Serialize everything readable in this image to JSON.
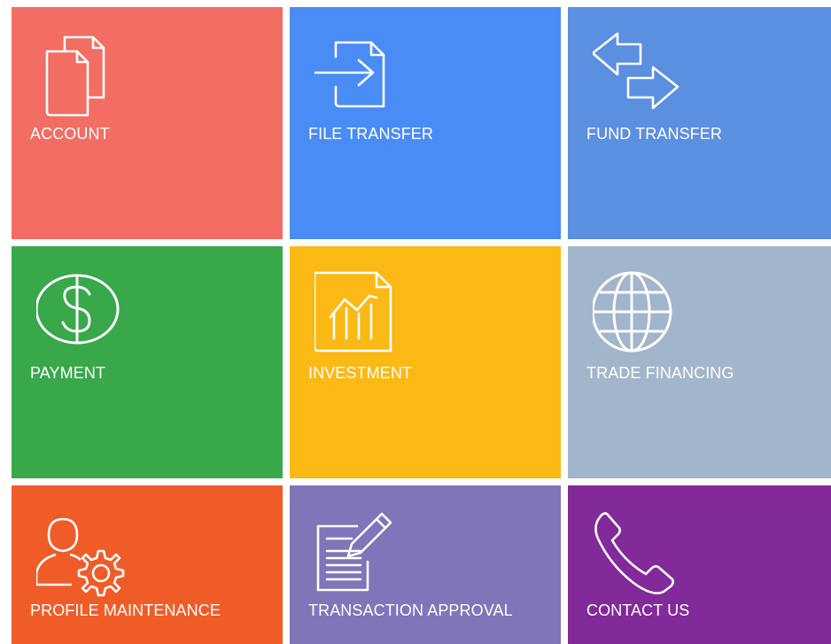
{
  "tiles": [
    {
      "label": "ACCOUNT",
      "icon": "documents-icon",
      "color": "#f26d63"
    },
    {
      "label": "FILE TRANSFER",
      "icon": "file-import-icon",
      "color": "#4a8cf5"
    },
    {
      "label": "FUND TRANSFER",
      "icon": "exchange-arrows-icon",
      "color": "#5b8fe0"
    },
    {
      "label": "PAYMENT",
      "icon": "dollar-coin-icon",
      "color": "#38a84b"
    },
    {
      "label": "INVESTMENT",
      "icon": "chart-document-icon",
      "color": "#fbb916"
    },
    {
      "label": "TRADE FINANCING",
      "icon": "globe-icon",
      "color": "#a2b5cb"
    },
    {
      "label": "PROFILE MAINTENANCE",
      "icon": "user-gear-icon",
      "color": "#f05c28"
    },
    {
      "label": "TRANSACTION APPROVAL",
      "icon": "document-pen-icon",
      "color": "#7f75b8"
    },
    {
      "label": "CONTACT US",
      "icon": "phone-icon",
      "color": "#822a99"
    }
  ]
}
